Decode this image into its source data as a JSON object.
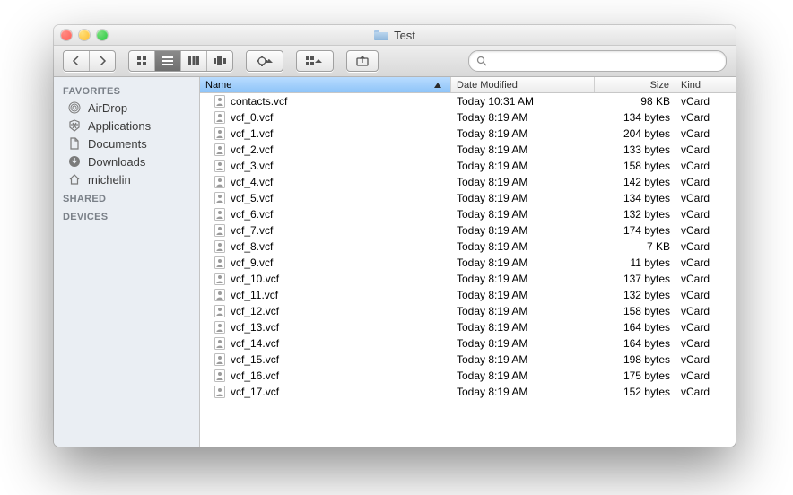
{
  "window": {
    "title": "Test"
  },
  "toolbar": {
    "search_placeholder": "",
    "search_value": ""
  },
  "sidebar": {
    "sections": [
      {
        "title": "FAVORITES",
        "items": [
          {
            "label": "AirDrop"
          },
          {
            "label": "Applications"
          },
          {
            "label": "Documents"
          },
          {
            "label": "Downloads"
          },
          {
            "label": "michelin"
          }
        ]
      },
      {
        "title": "SHARED",
        "items": []
      },
      {
        "title": "DEVICES",
        "items": []
      }
    ]
  },
  "columns": [
    {
      "label": "Name",
      "sorted": "asc"
    },
    {
      "label": "Date Modified"
    },
    {
      "label": "Size"
    },
    {
      "label": "Kind"
    }
  ],
  "files": [
    {
      "name": "contacts.vcf",
      "date": "Today 10:31 AM",
      "size": "98 KB",
      "kind": "vCard"
    },
    {
      "name": "vcf_0.vcf",
      "date": "Today 8:19 AM",
      "size": "134 bytes",
      "kind": "vCard"
    },
    {
      "name": "vcf_1.vcf",
      "date": "Today 8:19 AM",
      "size": "204 bytes",
      "kind": "vCard"
    },
    {
      "name": "vcf_2.vcf",
      "date": "Today 8:19 AM",
      "size": "133 bytes",
      "kind": "vCard"
    },
    {
      "name": "vcf_3.vcf",
      "date": "Today 8:19 AM",
      "size": "158 bytes",
      "kind": "vCard"
    },
    {
      "name": "vcf_4.vcf",
      "date": "Today 8:19 AM",
      "size": "142 bytes",
      "kind": "vCard"
    },
    {
      "name": "vcf_5.vcf",
      "date": "Today 8:19 AM",
      "size": "134 bytes",
      "kind": "vCard"
    },
    {
      "name": "vcf_6.vcf",
      "date": "Today 8:19 AM",
      "size": "132 bytes",
      "kind": "vCard"
    },
    {
      "name": "vcf_7.vcf",
      "date": "Today 8:19 AM",
      "size": "174 bytes",
      "kind": "vCard"
    },
    {
      "name": "vcf_8.vcf",
      "date": "Today 8:19 AM",
      "size": "7 KB",
      "kind": "vCard"
    },
    {
      "name": "vcf_9.vcf",
      "date": "Today 8:19 AM",
      "size": "11 bytes",
      "kind": "vCard"
    },
    {
      "name": "vcf_10.vcf",
      "date": "Today 8:19 AM",
      "size": "137 bytes",
      "kind": "vCard"
    },
    {
      "name": "vcf_11.vcf",
      "date": "Today 8:19 AM",
      "size": "132 bytes",
      "kind": "vCard"
    },
    {
      "name": "vcf_12.vcf",
      "date": "Today 8:19 AM",
      "size": "158 bytes",
      "kind": "vCard"
    },
    {
      "name": "vcf_13.vcf",
      "date": "Today 8:19 AM",
      "size": "164 bytes",
      "kind": "vCard"
    },
    {
      "name": "vcf_14.vcf",
      "date": "Today 8:19 AM",
      "size": "164 bytes",
      "kind": "vCard"
    },
    {
      "name": "vcf_15.vcf",
      "date": "Today 8:19 AM",
      "size": "198 bytes",
      "kind": "vCard"
    },
    {
      "name": "vcf_16.vcf",
      "date": "Today 8:19 AM",
      "size": "175 bytes",
      "kind": "vCard"
    },
    {
      "name": "vcf_17.vcf",
      "date": "Today 8:19 AM",
      "size": "152 bytes",
      "kind": "vCard"
    }
  ]
}
